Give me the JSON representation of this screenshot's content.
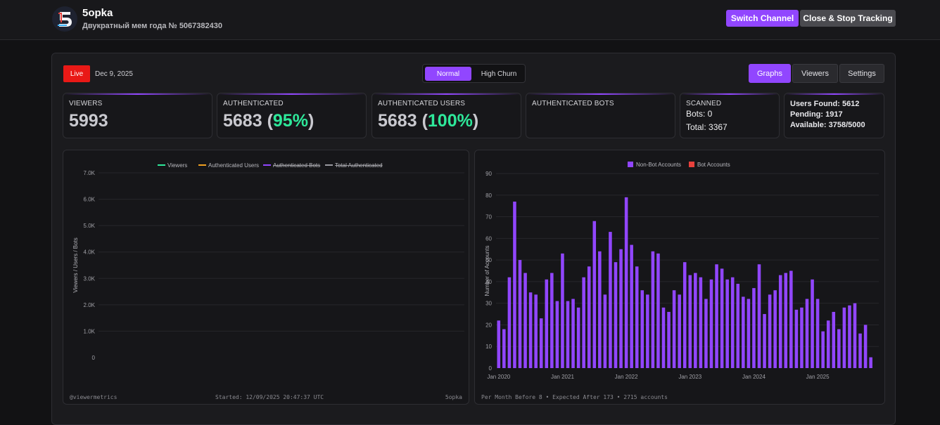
{
  "header": {
    "channel_name": "5opka",
    "stream_title": "Двукратный мем года № 5067382430",
    "switch_label": "Switch Channel",
    "close_label": "Close & Stop Tracking"
  },
  "toolbar": {
    "live_label": "Live",
    "date": "Dec 9, 2025",
    "mode_normal": "Normal",
    "mode_churn": "High Churn",
    "tab_graphs": "Graphs",
    "tab_viewers": "Viewers",
    "tab_settings": "Settings"
  },
  "stats": {
    "viewers": {
      "label": "VIEWERS",
      "value": "5993"
    },
    "authenticated": {
      "label": "AUTHENTICATED",
      "value": "5683",
      "pct": "95%"
    },
    "auth_users": {
      "label": "AUTHENTICATED USERS",
      "value": "5683",
      "pct": "100%"
    },
    "auth_bots": {
      "label": "AUTHENTICATED BOTS"
    },
    "scanned": {
      "label": "SCANNED",
      "bots": "Bots: 0",
      "total": "Total: 3367"
    },
    "users": {
      "found": "Users Found: 5612",
      "pending": "Pending: 1917",
      "available": "Available: 3758/5000"
    }
  },
  "colors": {
    "accent": "#9146ff",
    "live": "#e91916",
    "positive": "#2ee89a",
    "bot": "#e8413c",
    "viewers_line": "#2ee89a",
    "auth_users_line": "#f0a020",
    "auth_bots_line": "#9146ff",
    "total_auth_line": "#9a9aa0"
  },
  "line_chart": {
    "footer_left": "@viewermetrics",
    "footer_center": "Started: 12/09/2025 20:47:37 UTC",
    "footer_right": "5opka"
  },
  "bar_chart": {
    "footer": "Per Month Before 8 • Expected After 173 • 2715 accounts"
  },
  "chart_data": [
    {
      "type": "line",
      "title": "",
      "xlabel": "",
      "ylabel": "Viewers / Users / Bots",
      "ylim": [
        0,
        7000
      ],
      "yticks": [
        "0",
        "1.0K",
        "2.0K",
        "3.0K",
        "4.0K",
        "5.0K",
        "6.0K",
        "7.0K"
      ],
      "grid": true,
      "legend_position": "top-center",
      "series": [
        {
          "name": "Viewers",
          "values": [],
          "hidden": false
        },
        {
          "name": "Authenticated Users",
          "values": [],
          "hidden": false
        },
        {
          "name": "Authenticated Bots",
          "values": [],
          "hidden": true
        },
        {
          "name": "Total Authenticated",
          "values": [],
          "hidden": true
        }
      ]
    },
    {
      "type": "bar",
      "title": "",
      "xlabel": "",
      "ylabel": "Number of Accounts",
      "ylim": [
        0,
        90
      ],
      "yticks": [
        0,
        10,
        20,
        30,
        40,
        50,
        60,
        70,
        80,
        90
      ],
      "grid": true,
      "legend_position": "top-center",
      "x_tick_labels": [
        "Jan 2020",
        "Jan 2021",
        "Jan 2022",
        "Jan 2023",
        "Jan 2024",
        "Jan 2025"
      ],
      "categories": [
        "2020-01",
        "2020-02",
        "2020-03",
        "2020-04",
        "2020-05",
        "2020-06",
        "2020-07",
        "2020-08",
        "2020-09",
        "2020-10",
        "2020-11",
        "2020-12",
        "2021-01",
        "2021-02",
        "2021-03",
        "2021-04",
        "2021-05",
        "2021-06",
        "2021-07",
        "2021-08",
        "2021-09",
        "2021-10",
        "2021-11",
        "2021-12",
        "2022-01",
        "2022-02",
        "2022-03",
        "2022-04",
        "2022-05",
        "2022-06",
        "2022-07",
        "2022-08",
        "2022-09",
        "2022-10",
        "2022-11",
        "2022-12",
        "2023-01",
        "2023-02",
        "2023-03",
        "2023-04",
        "2023-05",
        "2023-06",
        "2023-07",
        "2023-08",
        "2023-09",
        "2023-10",
        "2023-11",
        "2023-12",
        "2024-01",
        "2024-02",
        "2024-03",
        "2024-04",
        "2024-05",
        "2024-06",
        "2024-07",
        "2024-08",
        "2024-09",
        "2024-10",
        "2024-11",
        "2024-12",
        "2025-01",
        "2025-02",
        "2025-03",
        "2025-04",
        "2025-05",
        "2025-06",
        "2025-07",
        "2025-08",
        "2025-09",
        "2025-10",
        "2025-11",
        "2025-12"
      ],
      "series": [
        {
          "name": "Non-Bot Accounts",
          "values": [
            22,
            18,
            42,
            77,
            50,
            44,
            35,
            34,
            23,
            41,
            44,
            31,
            53,
            31,
            32,
            28,
            42,
            47,
            68,
            54,
            34,
            63,
            49,
            55,
            79,
            57,
            47,
            36,
            34,
            54,
            53,
            28,
            26,
            36,
            34,
            49,
            43,
            44,
            42,
            32,
            41,
            48,
            46,
            41,
            42,
            39,
            33,
            32,
            37,
            48,
            25,
            34,
            36,
            43,
            44,
            45,
            27,
            28,
            32,
            41,
            32,
            17,
            22,
            26,
            18,
            28,
            29,
            30,
            16,
            20,
            5,
            0
          ]
        },
        {
          "name": "Bot Accounts",
          "values": []
        }
      ]
    }
  ]
}
